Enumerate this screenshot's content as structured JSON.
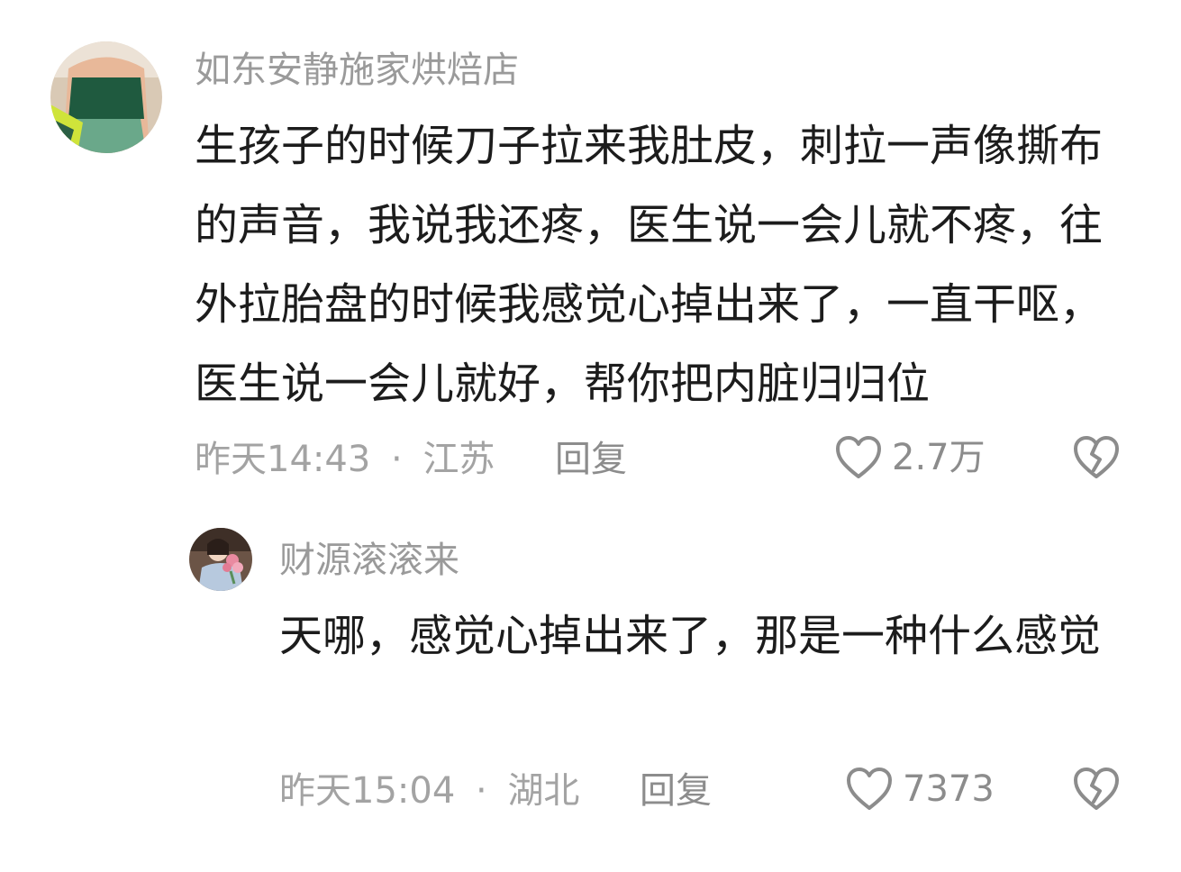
{
  "comments": [
    {
      "username": "如东安静施家烘焙店",
      "text": "生孩子的时候刀子拉来我肚皮，刺拉一声像撕布的声音，我说我还疼，医生说一会儿就不疼，往外拉胎盘的时候我感觉心掉出来了，一直干呕，医生说一会儿就好，帮你把内脏归归位",
      "time": "昨天14:43",
      "separator": "·",
      "location": "江苏",
      "reply_label": "回复",
      "likes": "2.7万",
      "avatar_icon": "avatar-green-top",
      "like_icon": "heart-outline-icon",
      "dislike_icon": "broken-heart-icon"
    }
  ],
  "replies": [
    {
      "username": "财源滚滚来",
      "text": "天哪，感觉心掉出来了，那是一种什么感觉",
      "time": "昨天15:04",
      "separator": "·",
      "location": "湖北",
      "reply_label": "回复",
      "likes": "7373",
      "avatar_icon": "avatar-flowers",
      "like_icon": "heart-outline-icon",
      "dislike_icon": "broken-heart-icon"
    }
  ],
  "colors": {
    "username": "#9a9a9a",
    "text": "#1c1c1c",
    "meta": "#a3a3a3",
    "icon": "#8c8c8c"
  }
}
